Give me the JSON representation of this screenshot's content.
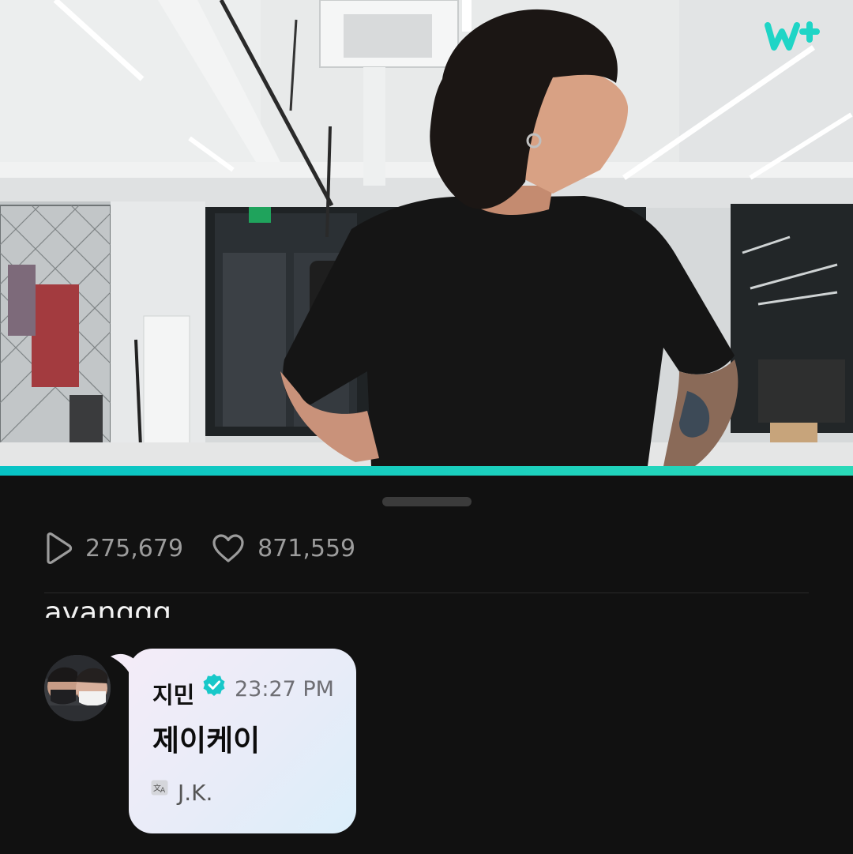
{
  "stats": {
    "plays": "275,679",
    "likes": "871,559"
  },
  "previous_comment": {
    "text": "ayanggg"
  },
  "comment": {
    "author": "지민",
    "time": "23:27 PM",
    "message": "제이케이",
    "translation": "J.K."
  },
  "player": {
    "progress": 1.0
  },
  "colors": {
    "accent": "#07c3c5",
    "background": "#111111"
  },
  "icons": {
    "logo": "weverse-logo",
    "plays": "play-outline-icon",
    "likes": "heart-outline-icon",
    "verified": "verified-badge-icon",
    "translate": "translate-icon"
  }
}
